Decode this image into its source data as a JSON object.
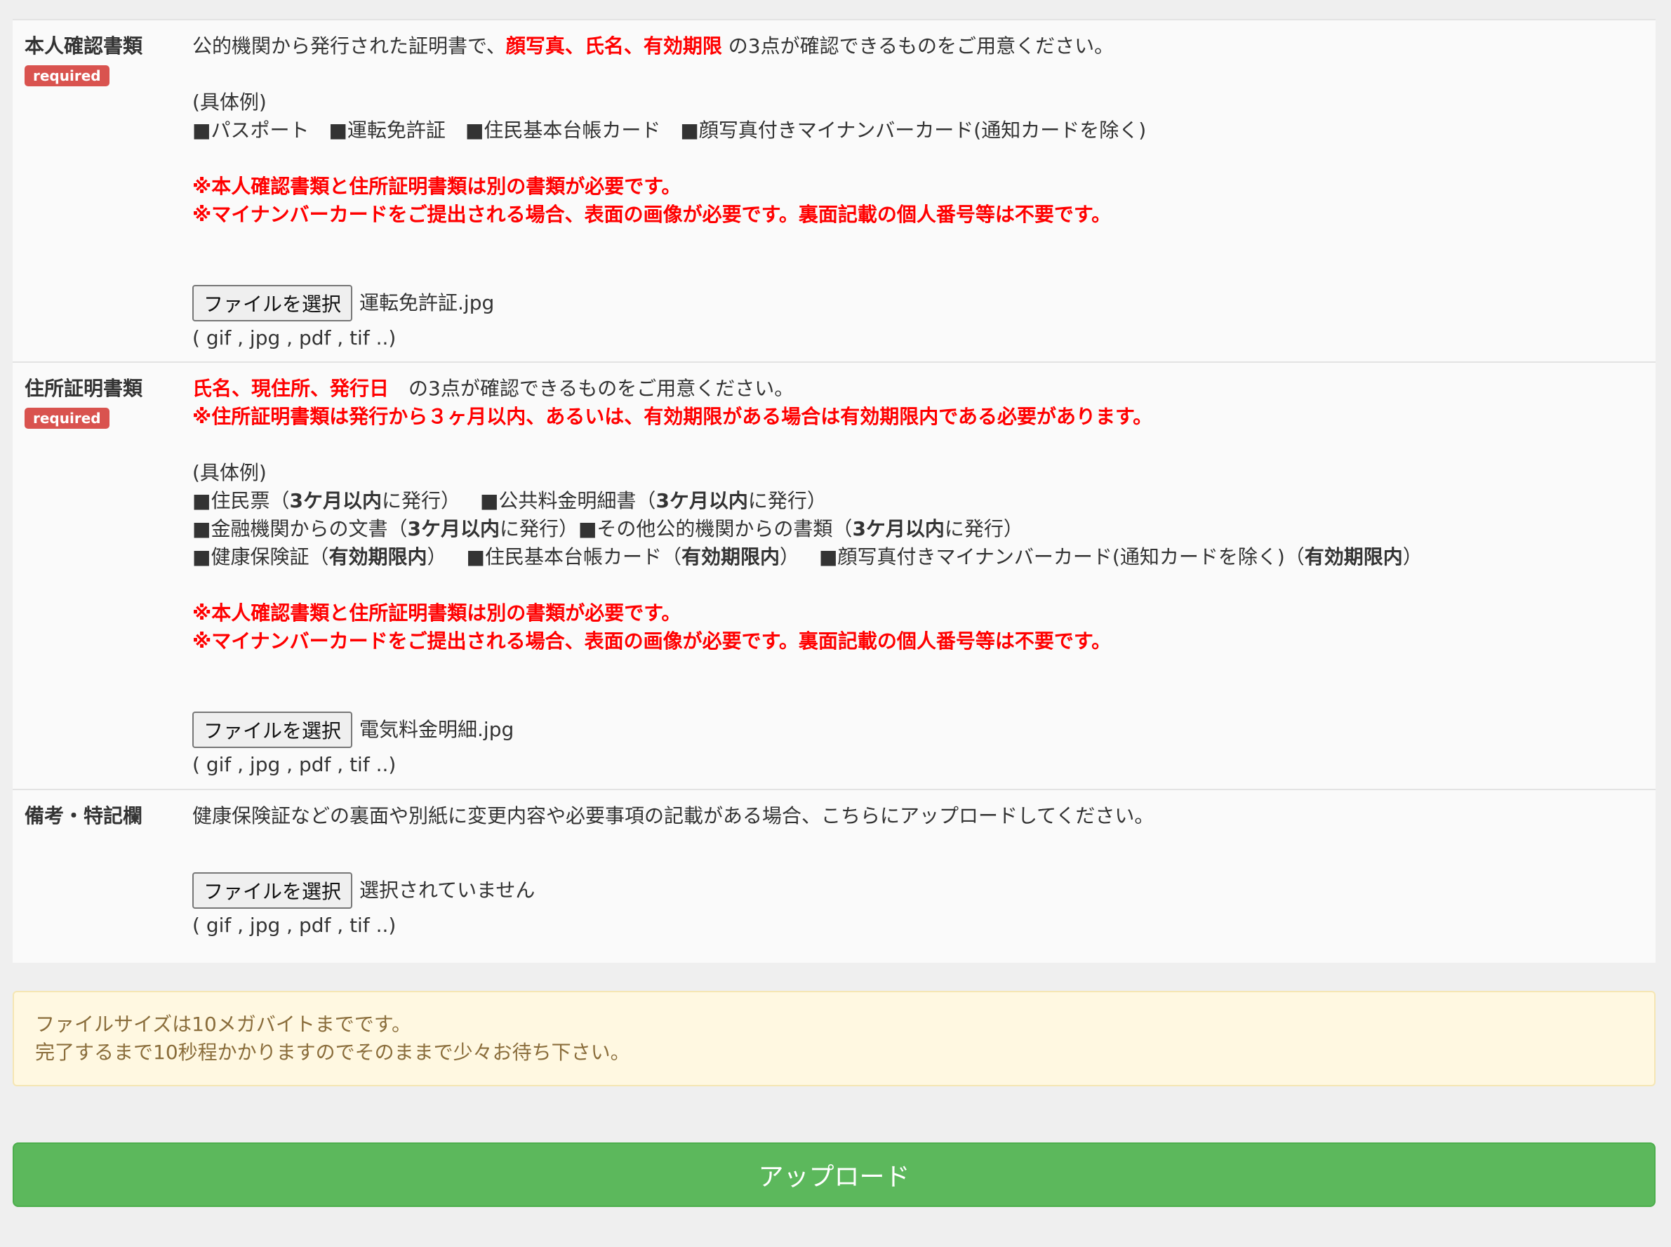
{
  "colors": {
    "accent_red": "#ff0000",
    "badge_red": "#d9534f",
    "upload_green": "#5cb85c",
    "notice_bg": "#fff8e1",
    "notice_text": "#8a6d3b"
  },
  "identity": {
    "label": "本人確認書類",
    "badge": "required",
    "intro_pre": "公的機関から発行された証明書で、",
    "intro_red": "顔写真、氏名、有効期限",
    "intro_post": " の3点が確認できるものをご用意ください。",
    "examples_heading": "(具体例)",
    "examples": [
      "■パスポート",
      "■運転免許証",
      "■住民基本台帳カード",
      "■顔写真付きマイナンバーカード(通知カードを除く)"
    ],
    "note1": "※本人確認書類と住所証明書類は別の書類が必要です。",
    "note2": "※マイナンバーカードをご提出される場合、表面の画像が必要です。裏面記載の個人番号等は不要です。",
    "file_button": "ファイルを選択",
    "file_name": "運転免許証.jpg",
    "ext_hint": "( gif , jpg , pdf , tif ..)"
  },
  "address": {
    "label": "住所証明書類",
    "badge": "required",
    "intro_red": "氏名、現住所、発行日",
    "intro_post": "　の3点が確認できるものをご用意ください。",
    "validity_note": "※住所証明書類は発行から３ヶ月以内、あるいは、有効期限がある場合は有効期限内である必要があります。",
    "examples_heading": "(具体例)",
    "ex1_a_pre": "■住民票（",
    "ex1_a_bold": "3ケ月以内",
    "ex1_a_post": "に発行）",
    "ex1_b_pre": "■公共料金明細書（",
    "ex1_b_bold": "3ケ月以内",
    "ex1_b_post": "に発行）",
    "ex2_a_pre": "■金融機関からの文書（",
    "ex2_a_bold": "3ケ月以内",
    "ex2_a_post": "に発行）",
    "ex2_b_pre": "■その他公的機関からの書類（",
    "ex2_b_bold": "3ケ月以内",
    "ex2_b_post": "に発行）",
    "ex3_a_pre": "■健康保険証（",
    "ex3_a_bold": "有効期限内",
    "ex3_a_post": "）",
    "ex3_b_pre": "■住民基本台帳カード（",
    "ex3_b_bold": "有効期限内",
    "ex3_b_post": "）",
    "ex3_c_pre": "■顔写真付きマイナンバーカード(通知カードを除く)（",
    "ex3_c_bold": "有効期限内",
    "ex3_c_post": "）",
    "note1": "※本人確認書類と住所証明書類は別の書類が必要です。",
    "note2": "※マイナンバーカードをご提出される場合、表面の画像が必要です。裏面記載の個人番号等は不要です。",
    "file_button": "ファイルを選択",
    "file_name": "電気料金明細.jpg",
    "ext_hint": "( gif , jpg , pdf , tif ..)"
  },
  "remarks": {
    "label": "備考・特記欄",
    "intro": "健康保険証などの裏面や別紙に変更内容や必要事項の記載がある場合、こちらにアップロードしてください。",
    "file_button": "ファイルを選択",
    "file_name": "選択されていません",
    "ext_hint": "( gif , jpg , pdf , tif ..)"
  },
  "notice": {
    "line1": "ファイルサイズは10メガバイトまでです。",
    "line2": "完了するまで10秒程かかりますのでそのままで少々お待ち下さい。"
  },
  "upload_button": "アップロード"
}
